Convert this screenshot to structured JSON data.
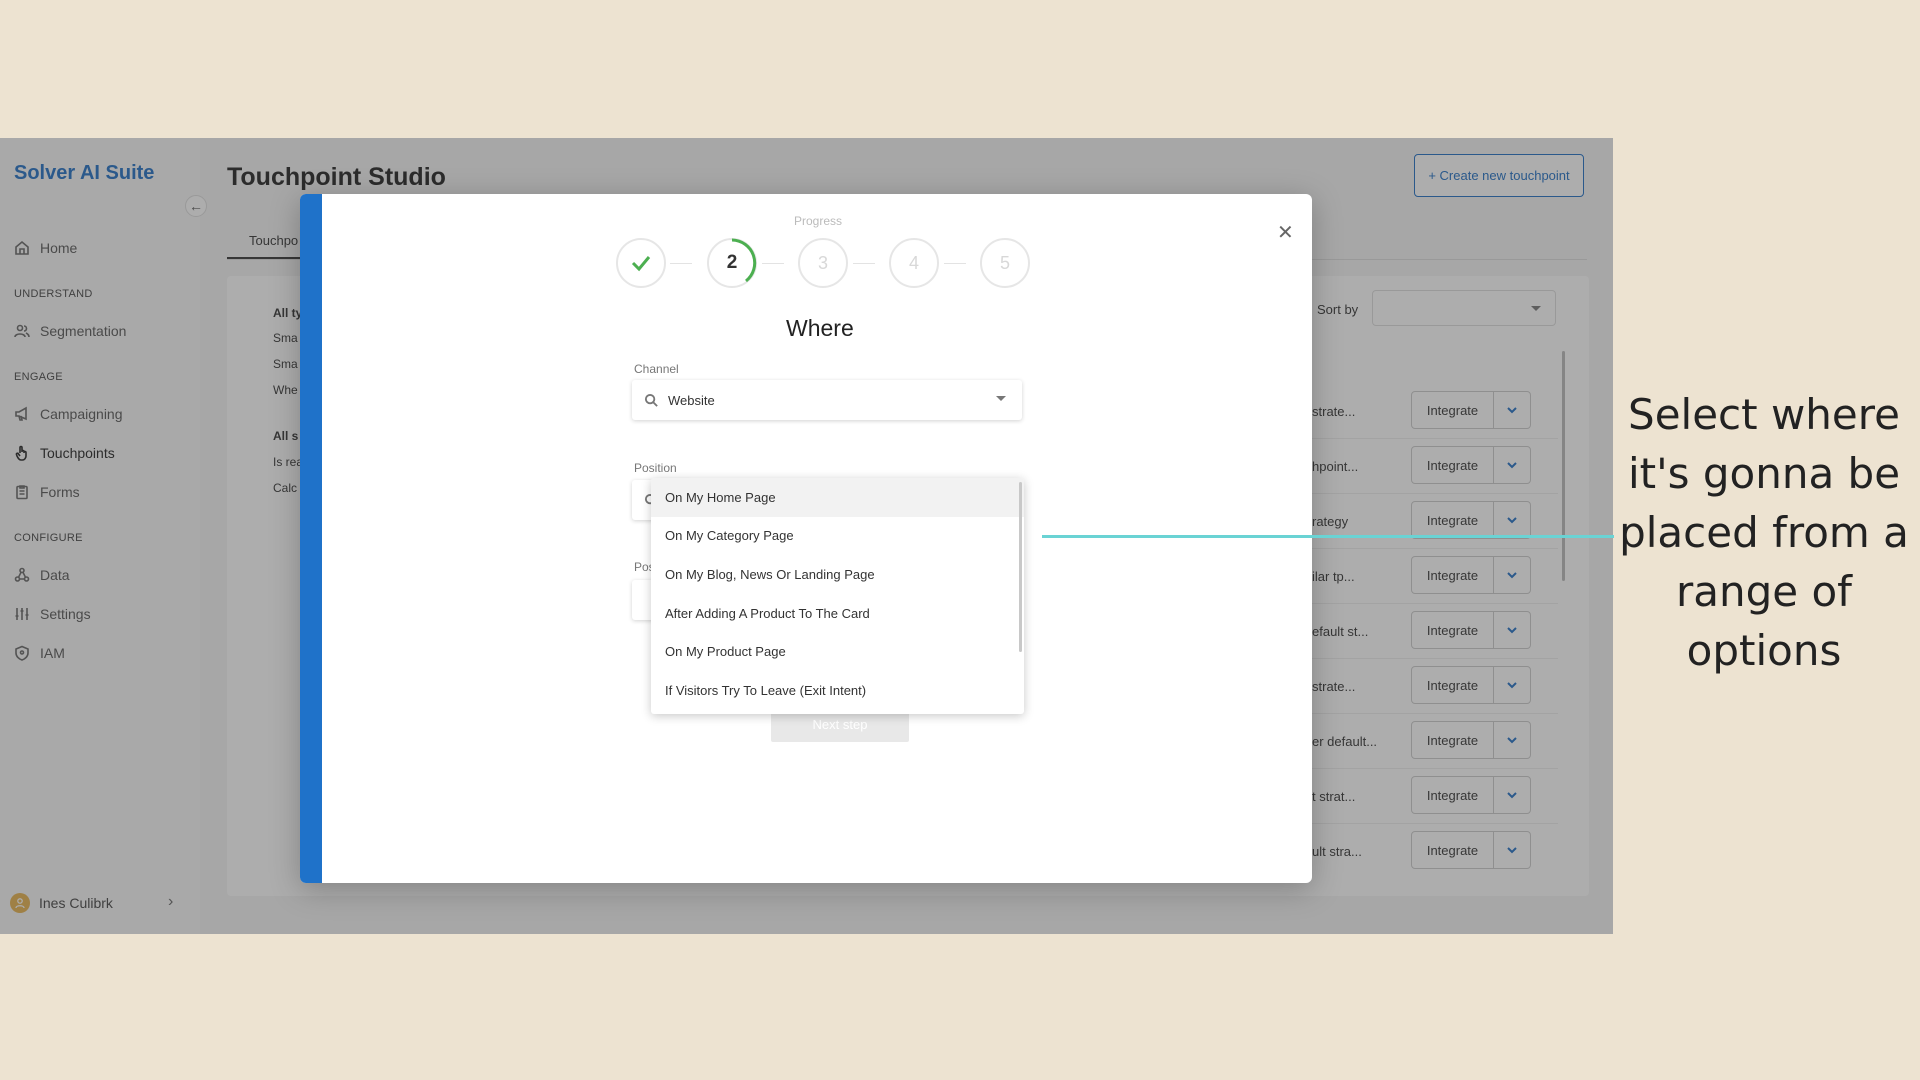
{
  "sidebar": {
    "brand": "Solver AI Suite",
    "home": "Home",
    "section_understand": "UNDERSTAND",
    "segmentation": "Segmentation",
    "section_engage": "ENGAGE",
    "campaigning": "Campaigning",
    "touchpoints": "Touchpoints",
    "forms": "Forms",
    "section_configure": "CONFIGURE",
    "data": "Data",
    "settings": "Settings",
    "iam": "IAM",
    "user_name": "Ines Culibrk"
  },
  "main": {
    "title": "Touchpoint Studio",
    "create_button": "+ Create new touchpoint",
    "tab_label": "Touchpo",
    "sort_label": "Sort by",
    "filters": [
      "All ty",
      "Sma",
      "Sma",
      "Whe",
      "All s",
      "Is rea",
      "Calc"
    ],
    "rows": [
      {
        "text": "strate...",
        "action": "Integrate"
      },
      {
        "text": "hpoint...",
        "action": "Integrate"
      },
      {
        "text": "rategy",
        "action": "Integrate"
      },
      {
        "text": "ilar tp...",
        "action": "Integrate"
      },
      {
        "text": "efault st...",
        "action": "Integrate"
      },
      {
        "text": "strate...",
        "action": "Integrate"
      },
      {
        "text": "er default...",
        "action": "Integrate"
      },
      {
        "text": "t strat...",
        "action": "Integrate"
      },
      {
        "text": "ult stra...",
        "action": "Integrate"
      }
    ]
  },
  "modal": {
    "progress_label": "Progress",
    "steps": [
      "",
      "2",
      "3",
      "4",
      "5"
    ],
    "current_step": 2,
    "title": "Where",
    "channel_label": "Channel",
    "channel_value": "Website",
    "position_label": "Position",
    "position_label_2": "Pos",
    "next_button": "Next step",
    "position_options": [
      "On My Home Page",
      "On My Category Page",
      "On My Blog, News Or Landing Page",
      "After Adding A Product To The Card",
      "On My Product Page",
      "If Visitors Try To Leave (Exit Intent)"
    ]
  },
  "annotation": {
    "text": "Select where it's gonna be placed from a range of options"
  },
  "colors": {
    "brand": "#1f6fc5",
    "stripe": "#1f72c9",
    "step_done": "#4caf50",
    "connector": "#6ad3d4",
    "background": "#ede3d1"
  }
}
